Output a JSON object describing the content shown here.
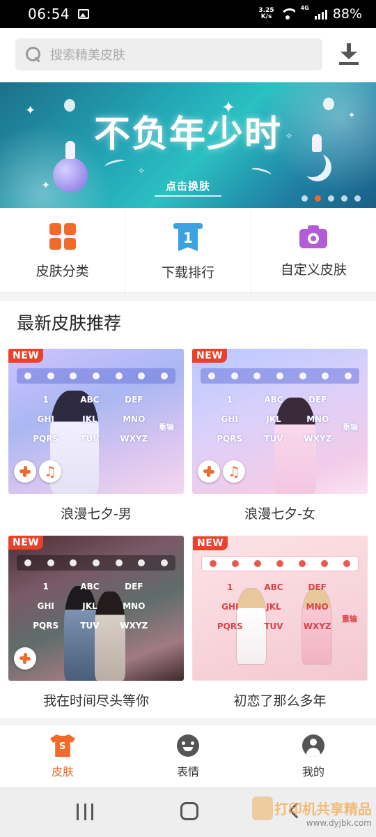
{
  "status_bar": {
    "time": "06:54",
    "network_speed_value": "3.25",
    "network_speed_unit": "K/s",
    "network_type": "4G",
    "battery": "88%"
  },
  "search": {
    "placeholder": "搜索精美皮肤"
  },
  "banner": {
    "title": "不负年少时",
    "button": "点击换肤",
    "page_count": 5,
    "active_page": 1
  },
  "categories": [
    {
      "label": "皮肤分类",
      "icon": "grid-icon",
      "color": "#f26a2a"
    },
    {
      "label": "下载排行",
      "icon": "ranking-ribbon-icon",
      "color": "#3aa2e0",
      "badge": "1"
    },
    {
      "label": "自定义皮肤",
      "icon": "camera-icon",
      "color": "#b15dd6"
    }
  ],
  "section": {
    "title": "最新皮肤推荐"
  },
  "skins": [
    {
      "name": "浪漫七夕-男",
      "badge": "NEW"
    },
    {
      "name": "浪漫七夕-女",
      "badge": "NEW"
    },
    {
      "name": "我在时间尽头等你",
      "badge": "NEW"
    },
    {
      "name": "初恋了那么多年",
      "badge": "NEW"
    }
  ],
  "keyboard_preview": {
    "row1": [
      "1",
      "ABC",
      "DEF"
    ],
    "row2": [
      "GHI",
      "JKL",
      "MNO"
    ],
    "row3": [
      "PQRS",
      "TUV",
      "WXYZ"
    ],
    "side": "重输"
  },
  "bottom_nav": [
    {
      "label": "皮肤",
      "icon": "shirt-icon",
      "active": true
    },
    {
      "label": "表情",
      "icon": "emoji-icon",
      "active": false
    },
    {
      "label": "我的",
      "icon": "profile-icon",
      "active": false
    }
  ],
  "watermark": {
    "main": "打印机共享精品",
    "sub": "www.dyjbk.com"
  },
  "colors": {
    "accent": "#f26a2a",
    "new_badge": "#e8412c"
  }
}
